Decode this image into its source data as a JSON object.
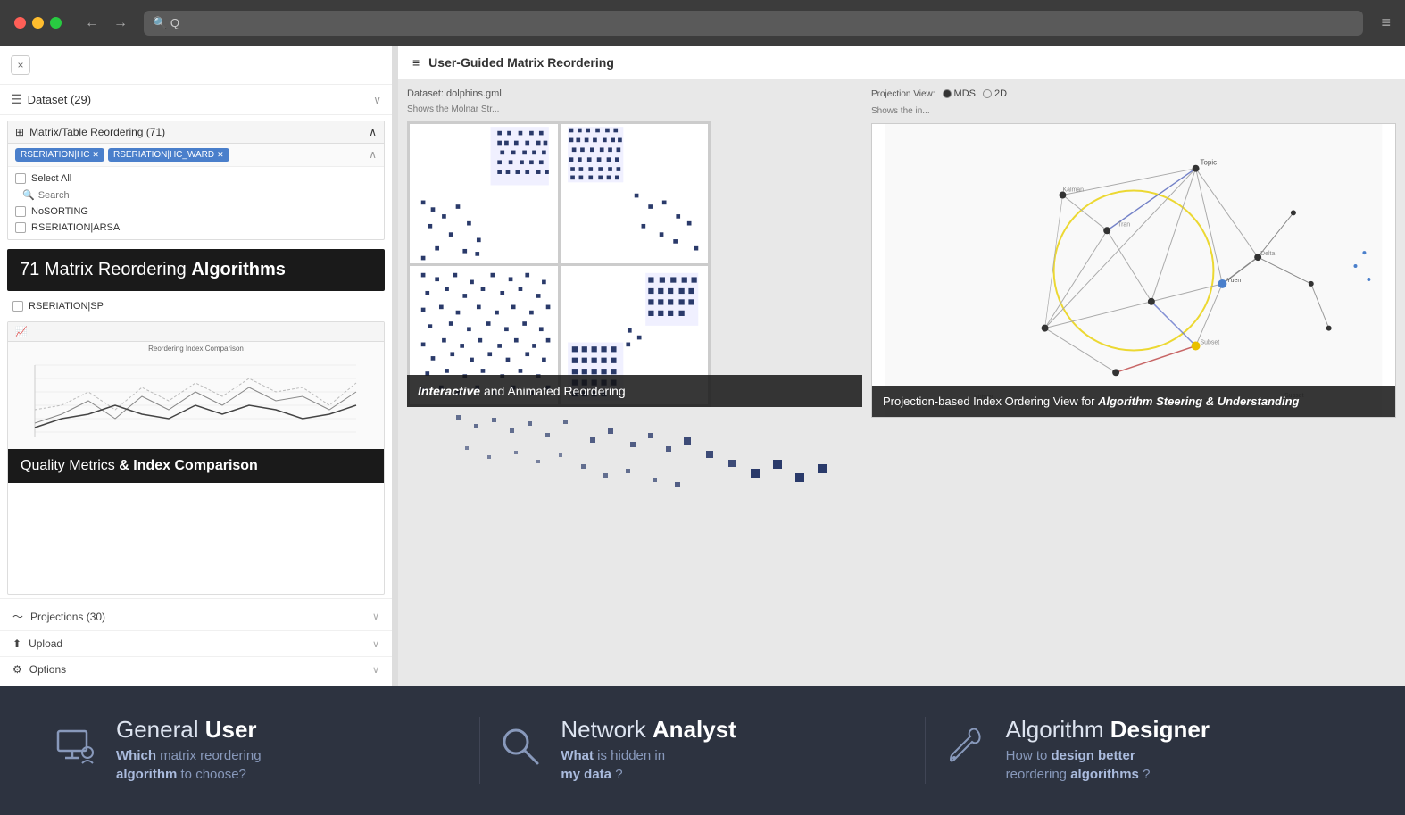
{
  "browser": {
    "address_placeholder": "Q",
    "menu_icon": "≡"
  },
  "sidebar": {
    "close_label": "×",
    "dataset_label": "Dataset (29)",
    "matrix_panel_label": "Matrix/Table Reordering (71)",
    "tag1": "RSERIATION|HC",
    "tag2": "RSERIATION|HC_WARD",
    "select_all_label": "Select All",
    "search_placeholder": "Search",
    "no_sorting_label": "NoSORTING",
    "rsa_label": "RSERIATION|ARSA",
    "rsp_label": "RSERIATION|SP",
    "count_num": "71",
    "count_text": "Matrix Reordering ",
    "count_bold": "Algorithms",
    "quality_metrics_label": "Quality Metrics",
    "quality_bold": "& Index Comparison",
    "quality_full": "Quality Metrics & Index Comparison",
    "chart_title": "Reordering Index Comparison",
    "projections_label": "Projections (30)",
    "upload_label": "Upload",
    "options_label": "Options"
  },
  "content": {
    "header_icon": "≡",
    "header_title": "User-Guided Matrix Reordering",
    "dataset_info": "Dataset: dolphins.gml",
    "shows_label": "Shows the Molnar Str...",
    "matrix_card_bold": "Interactive",
    "matrix_card_normal": " and Animated Reordering",
    "projection_label": "Projection View:",
    "projection_opts": [
      "MDS",
      "2D"
    ],
    "projection_shows": "Shows the in...",
    "projection_card_text": "Projection-based Index Ordering View for ",
    "projection_card_bold": "Algorithm Steering & Understanding"
  },
  "footer": {
    "items": [
      {
        "icon": "monitor-user",
        "title_normal": "General ",
        "title_bold": "User",
        "desc_bold1": "Which",
        "desc_normal1": " matrix reordering",
        "desc_bold2": "algorithm",
        "desc_normal2": " to choose?"
      },
      {
        "icon": "search",
        "title_normal": "Network ",
        "title_bold": "Analyst",
        "desc_bold1": "What",
        "desc_normal1": " is hidden in",
        "desc_bold2": "my data",
        "desc_normal2": "?"
      },
      {
        "icon": "wrench",
        "title_normal": "Algorithm ",
        "title_bold": "Designer",
        "desc_normal1": "How to ",
        "desc_bold1": "design better",
        "desc_normal2": " reordering ",
        "desc_bold2": "algorithms",
        "desc_normal3": "?"
      }
    ]
  }
}
